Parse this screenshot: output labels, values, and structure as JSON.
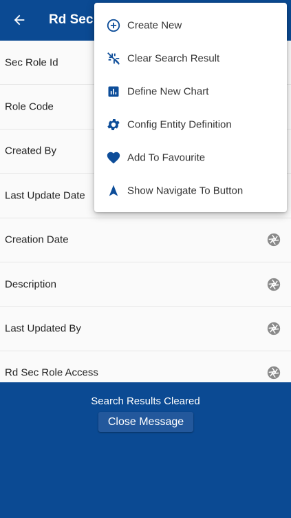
{
  "app_bar": {
    "title": "Rd Sec Role",
    "back_icon": "arrow-left-icon"
  },
  "fields": [
    {
      "label": "Sec Role Id"
    },
    {
      "label": "Role Code"
    },
    {
      "label": "Created By"
    },
    {
      "label": "Last Update Date"
    },
    {
      "label": "Creation Date",
      "icon": "aperture-icon"
    },
    {
      "label": "Description",
      "icon": "aperture-icon"
    },
    {
      "label": "Last Updated By",
      "icon": "aperture-icon"
    },
    {
      "label": "Rd Sec Role Access",
      "icon": "aperture-icon"
    }
  ],
  "menu": {
    "items": [
      {
        "label": "Create New",
        "icon": "add-circle-icon"
      },
      {
        "label": "Clear Search Result",
        "icon": "clear-search-icon"
      },
      {
        "label": "Define New Chart",
        "icon": "chart-icon"
      },
      {
        "label": "Config Entity Definition",
        "icon": "gear-icon"
      },
      {
        "label": "Add To Favourite",
        "icon": "heart-icon"
      },
      {
        "label": "Show Navigate To Button",
        "icon": "navigation-arrow-icon"
      }
    ]
  },
  "toast": {
    "message": "Search Results Cleared",
    "button_label": "Close Message"
  },
  "colors": {
    "primary": "#0b4a93",
    "accent": "#0d4d99",
    "icon_gray": "#8a8a8a"
  }
}
